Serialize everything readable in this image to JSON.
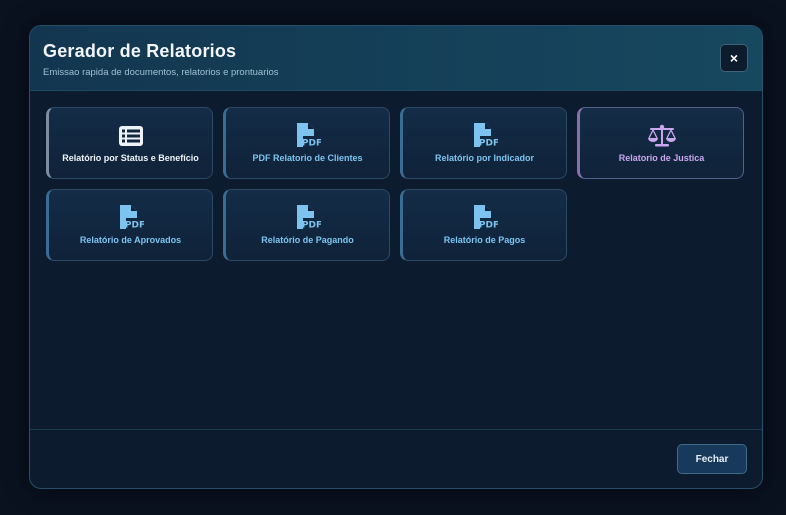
{
  "modal": {
    "title": "Gerador de Relatorios",
    "subtitle": "Emissao rapida de documentos, relatorios e prontuarios",
    "close_label": "×"
  },
  "reports": [
    {
      "label": "Relatório por Status e Benefício",
      "icon": "list-icon",
      "accent": "#eef3f8"
    },
    {
      "label": "PDF Relatorio de Clientes",
      "icon": "pdf-file-icon",
      "accent": "#7cc4ef"
    },
    {
      "label": "Relatório por Indicador",
      "icon": "pdf-file-icon",
      "accent": "#7cc4ef"
    },
    {
      "label": "Relatorio de Justica",
      "icon": "scale-icon",
      "accent": "#c9a6ee"
    },
    {
      "label": "Relatório de Aprovados",
      "icon": "pdf-file-icon",
      "accent": "#7cc4ef"
    },
    {
      "label": "Relatório de Pagando",
      "icon": "pdf-file-icon",
      "accent": "#7cc4ef"
    },
    {
      "label": "Relatório de Pagos",
      "icon": "pdf-file-icon",
      "accent": "#7cc4ef"
    }
  ],
  "footer": {
    "close_button": "Fechar"
  },
  "icon_text": {
    "pdf": "PDF"
  }
}
